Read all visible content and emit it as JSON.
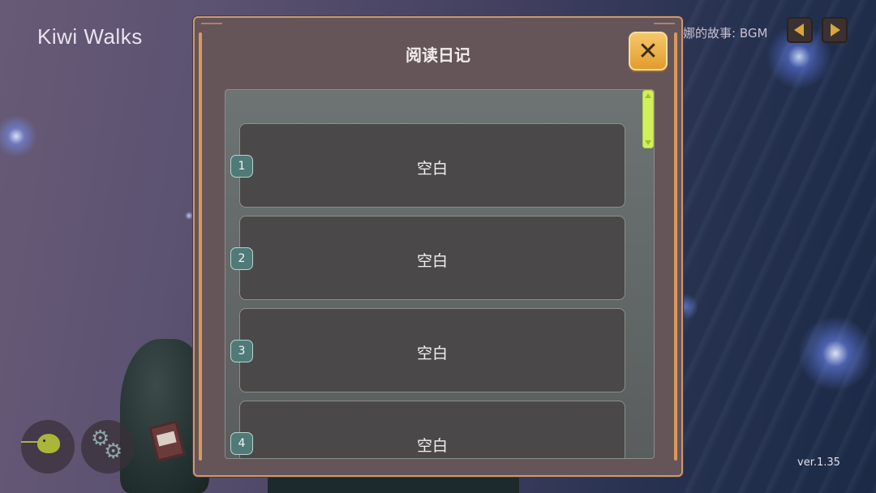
{
  "game": {
    "title": "Kiwi Walks",
    "version": "ver.1.35",
    "bgm_label": "娜的故事: BGM"
  },
  "controls": {
    "prev_icon": "triangle-left",
    "next_icon": "triangle-right",
    "accent_color": "#d9a53c"
  },
  "dialog": {
    "title": "阅读日记",
    "close_icon": "close-x",
    "close_color": "#e9ab44",
    "slots": [
      {
        "number": "1",
        "label": "空白"
      },
      {
        "number": "2",
        "label": "空白"
      },
      {
        "number": "3",
        "label": "空白"
      },
      {
        "number": "4",
        "label": "空白"
      }
    ]
  },
  "bottom_bar": {
    "kiwi_icon": "kiwi-bird",
    "settings_icon": "gears",
    "diary_icon": "book"
  }
}
